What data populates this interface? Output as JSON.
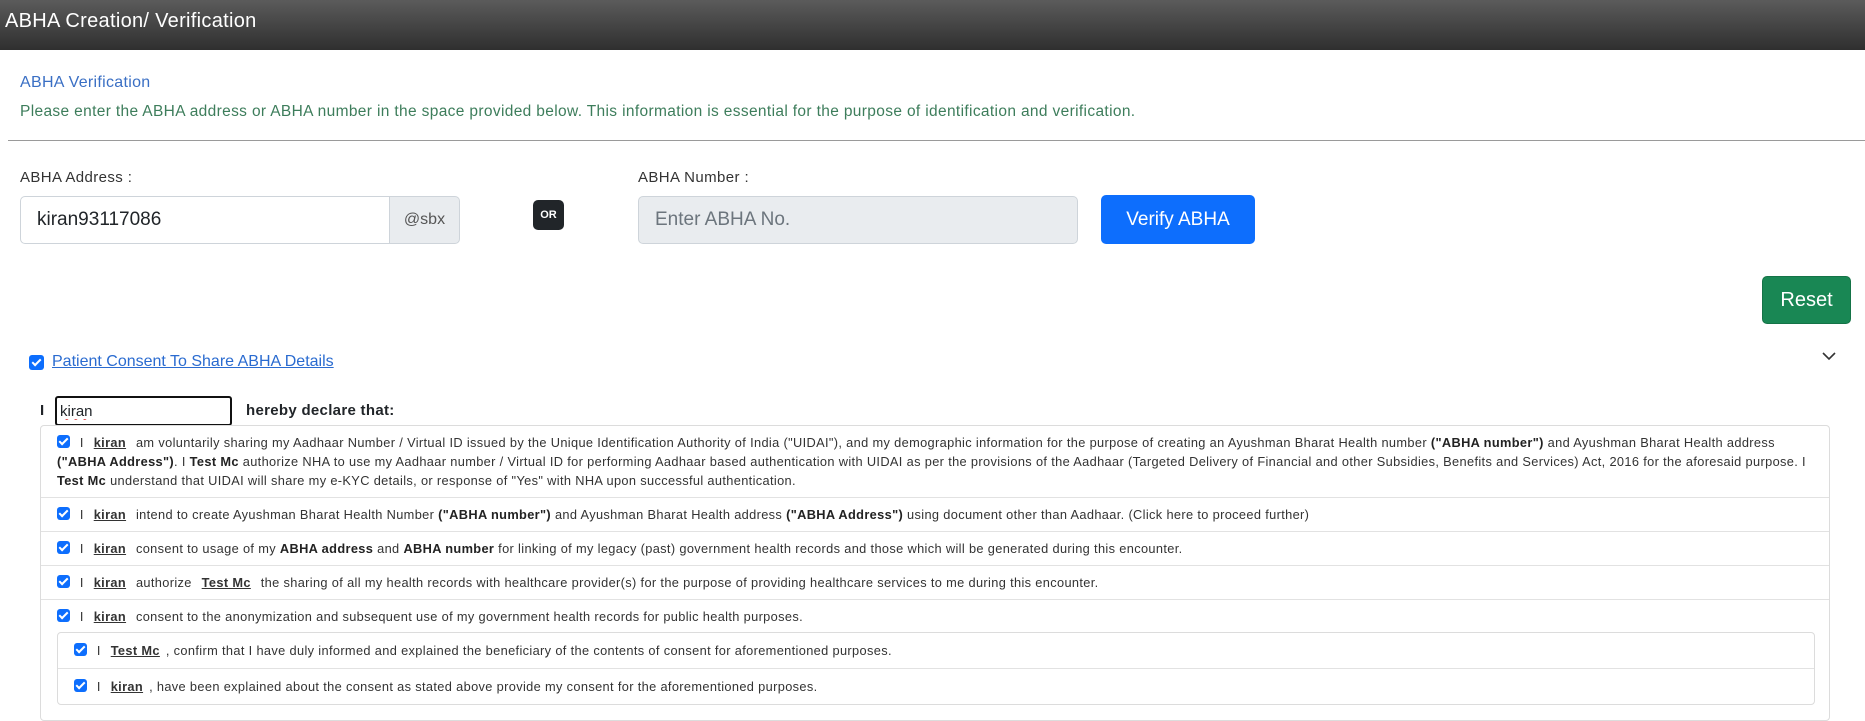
{
  "window": {
    "title": "ABHA Creation/ Verification"
  },
  "verification": {
    "title": "ABHA Verification",
    "description": "Please enter the ABHA address or ABHA number in the space provided below. This information is essential for the purpose of identification and verification."
  },
  "form": {
    "address_label": "ABHA Address :",
    "address_value": "kiran93117086",
    "address_suffix": "@sbx",
    "or_label": "OR",
    "number_label": "ABHA Number :",
    "number_placeholder": "Enter ABHA No.",
    "verify_label": "Verify ABHA",
    "reset_label": "Reset"
  },
  "consent": {
    "checked": true,
    "title": "Patient Consent To Share ABHA Details",
    "i_label": "I",
    "name_value": "kiran",
    "declare_label": "hereby declare that:",
    "patient_name": "kiran",
    "provider_name": "Test Mc",
    "item1": {
      "p1": "am voluntarily sharing my Aadhaar Number / Virtual ID issued by the Unique Identification Authority of India (\"UIDAI\"), and my demographic information for the purpose of creating an Ayushman Bharat Health number",
      "b1": "(\"ABHA number\")",
      "p2": "and Ayushman Bharat Health address",
      "b2": "(\"ABHA Address\")",
      "p3": ". I",
      "p4": "authorize NHA to use my Aadhaar number / Virtual ID for performing Aadhaar based authentication with UIDAI as per the provisions of the Aadhaar (Targeted Delivery of Financial and other Subsidies, Benefits and Services) Act, 2016 for the aforesaid purpose. I",
      "p5": "understand that UIDAI will share my e-KYC details, or response of \"Yes\" with NHA upon successful authentication."
    },
    "item2": {
      "p1": "intend to create Ayushman Bharat Health Number",
      "b1": "(\"ABHA number\")",
      "p2": "and Ayushman Bharat Health address",
      "b2": "(\"ABHA Address\")",
      "p3": "using document other than Aadhaar. (Click here to proceed further)"
    },
    "item3": {
      "p1": "consent to usage of my",
      "b1": "ABHA address",
      "p2": "and",
      "b2": "ABHA number",
      "p3": "for linking of my legacy (past) government health records and those which will be generated during this encounter."
    },
    "item4": {
      "p1": "authorize",
      "p2": "the sharing of all my health records with healthcare provider(s) for the purpose of providing healthcare services to me during this encounter."
    },
    "item5": {
      "p1": "consent to the anonymization and subsequent use of my government health records for public health purposes."
    },
    "item6": {
      "p1": ", confirm that I have duly informed and explained the beneficiary of the contents of consent for aforementioned purposes."
    },
    "item7": {
      "p1": ", have been explained about the consent as stated above provide my consent for the aforementioned purposes."
    }
  }
}
